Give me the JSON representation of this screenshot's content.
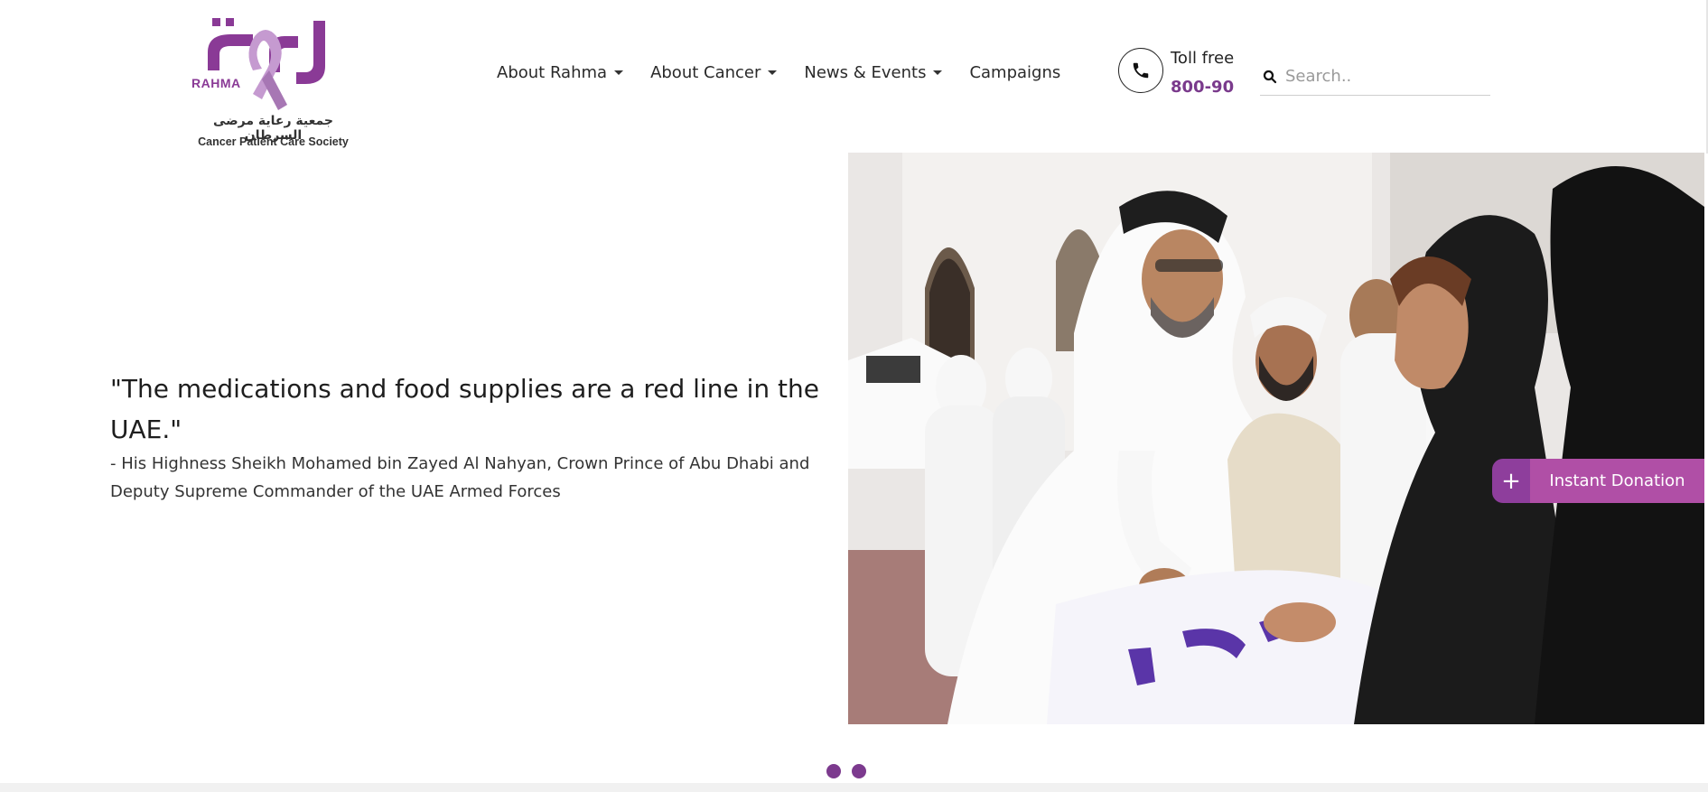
{
  "logo": {
    "brand_en": "RAHMA",
    "name_ar": "جمعية رعاية مرضى السرطان",
    "name_en": "Cancer Patient Care Society",
    "brand_color": "#8a3a96"
  },
  "nav": {
    "items": [
      {
        "label": "About Rahma",
        "has_dropdown": true
      },
      {
        "label": "About Cancer",
        "has_dropdown": true
      },
      {
        "label": "News & Events",
        "has_dropdown": true
      },
      {
        "label": "Campaigns",
        "has_dropdown": false
      }
    ]
  },
  "contact": {
    "icon": "phone-icon",
    "toll_label": "Toll free",
    "toll_number": "800-90"
  },
  "search": {
    "placeholder": "Search..",
    "value": "",
    "icon": "search-icon"
  },
  "hero": {
    "quote": "\"The medications and food supplies are a red line in the UAE.\"",
    "attribution": "- His Highness Sheikh Mohamed bin Zayed Al Nahyan, Crown Prince of Abu Dhabi and Deputy Supreme Commander of the UAE Armed Forces"
  },
  "donation": {
    "plus": "+",
    "label": "Instant Donation",
    "accent": "#8e3e9c",
    "bg": "#b04fa6"
  },
  "slider": {
    "dot_count": 2
  }
}
